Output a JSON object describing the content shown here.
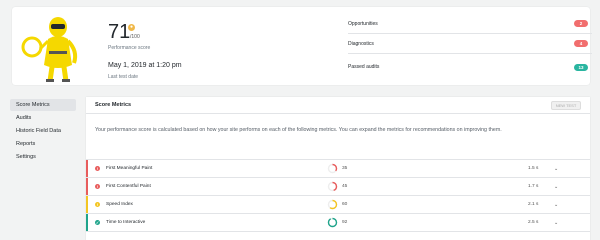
{
  "summary": {
    "score": "71",
    "score_max": "/100",
    "score_label": "Performance score",
    "test_date": "May 1, 2019 at 1:20 pm",
    "test_date_label": "Last test date",
    "stats": [
      {
        "label": "Opportunities",
        "value": "2",
        "color": "#f16e6e"
      },
      {
        "label": "Diagnostics",
        "value": "4",
        "color": "#f16e6e"
      },
      {
        "label": "Passed audits",
        "value": "13",
        "color": "#2ab5a0"
      }
    ]
  },
  "sidebar": {
    "items": [
      {
        "label": "Score Metrics",
        "active": true
      },
      {
        "label": "Audits"
      },
      {
        "label": "Historic Field Data"
      },
      {
        "label": "Reports"
      },
      {
        "label": "Settings"
      }
    ]
  },
  "panel": {
    "title": "Score Metrics",
    "new_test_label": "NEW TEST",
    "description": "Your performance score is calculated based on how your site performs on each of the following metrics. You can expand the metrics for recommendations on improving them."
  },
  "metrics": [
    {
      "name": "First Meaningful Paint",
      "score": "35",
      "score_value": 35,
      "time": "1.5 s",
      "status": "fail",
      "color": "#e85c5c",
      "icon": "!"
    },
    {
      "name": "First Contentful Paint",
      "score": "45",
      "score_value": 45,
      "time": "1.7 s",
      "status": "fail",
      "color": "#e85c5c",
      "icon": "!"
    },
    {
      "name": "Speed Index",
      "score": "60",
      "score_value": 60,
      "time": "2.1 s",
      "status": "warn",
      "color": "#f3c522",
      "icon": "!"
    },
    {
      "name": "Time to Interactive",
      "score": "92",
      "score_value": 92,
      "time": "2.5 s",
      "status": "pass",
      "color": "#1fa48b",
      "icon": "✓"
    }
  ]
}
